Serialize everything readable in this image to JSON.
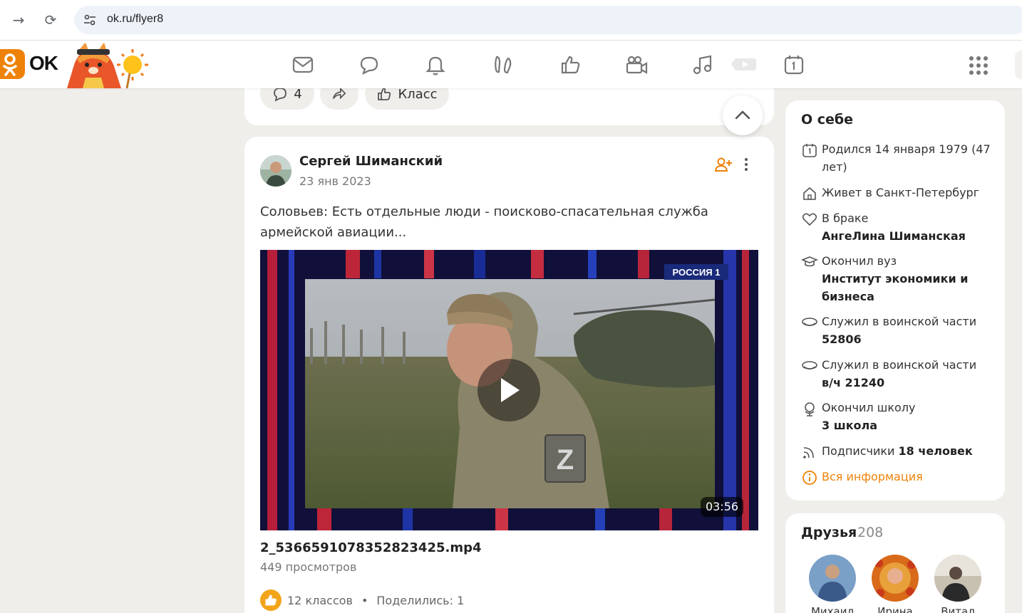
{
  "browser": {
    "url": "ok.ru/flyer8"
  },
  "header": {
    "logo_text": "OK"
  },
  "prev_post": {
    "comments_count": "4",
    "class_label": "Класс"
  },
  "post": {
    "author": "Сергей Шиманский",
    "date": "23 янв 2023",
    "text": "Соловьев: Есть отдельные люди - поисково-спасательная служба армейской авиации...",
    "video": {
      "channel_badge": "РОССИЯ 1",
      "duration": "03:56",
      "patch_letter": "Z"
    },
    "video_title": "2_5366591078352823425.mp4",
    "views": "449 просмотров",
    "likes": "12 классов",
    "separator": "•",
    "shares": "Поделились: 1"
  },
  "about": {
    "title": "О себе",
    "born": "Родился 14 января 1979 (47 лет)",
    "lives": "Живет в Санкт-Петербург",
    "married_label": "В браке",
    "married_name": "АнгеЛина Шиманская",
    "uni_label": "Окончил вуз",
    "uni_name": "Институт экономики и бизнеса",
    "service1_label": "Служил в воинской части",
    "service1_value": "52806",
    "service2_label": "Служил в воинской части",
    "service2_value": "в/ч 21240",
    "school_label": "Окончил школу",
    "school_value": "3 школа",
    "subs_label": "Подписчики",
    "subs_value": "18 человек",
    "all_info": "Вся информация"
  },
  "friends": {
    "title": "Друзья",
    "count": "208",
    "items": [
      {
        "name": "Михаил"
      },
      {
        "name": "Ирина"
      },
      {
        "name": "Витал"
      }
    ]
  },
  "colors": {
    "accent": "#ee8208",
    "background": "#f0eeeb"
  }
}
